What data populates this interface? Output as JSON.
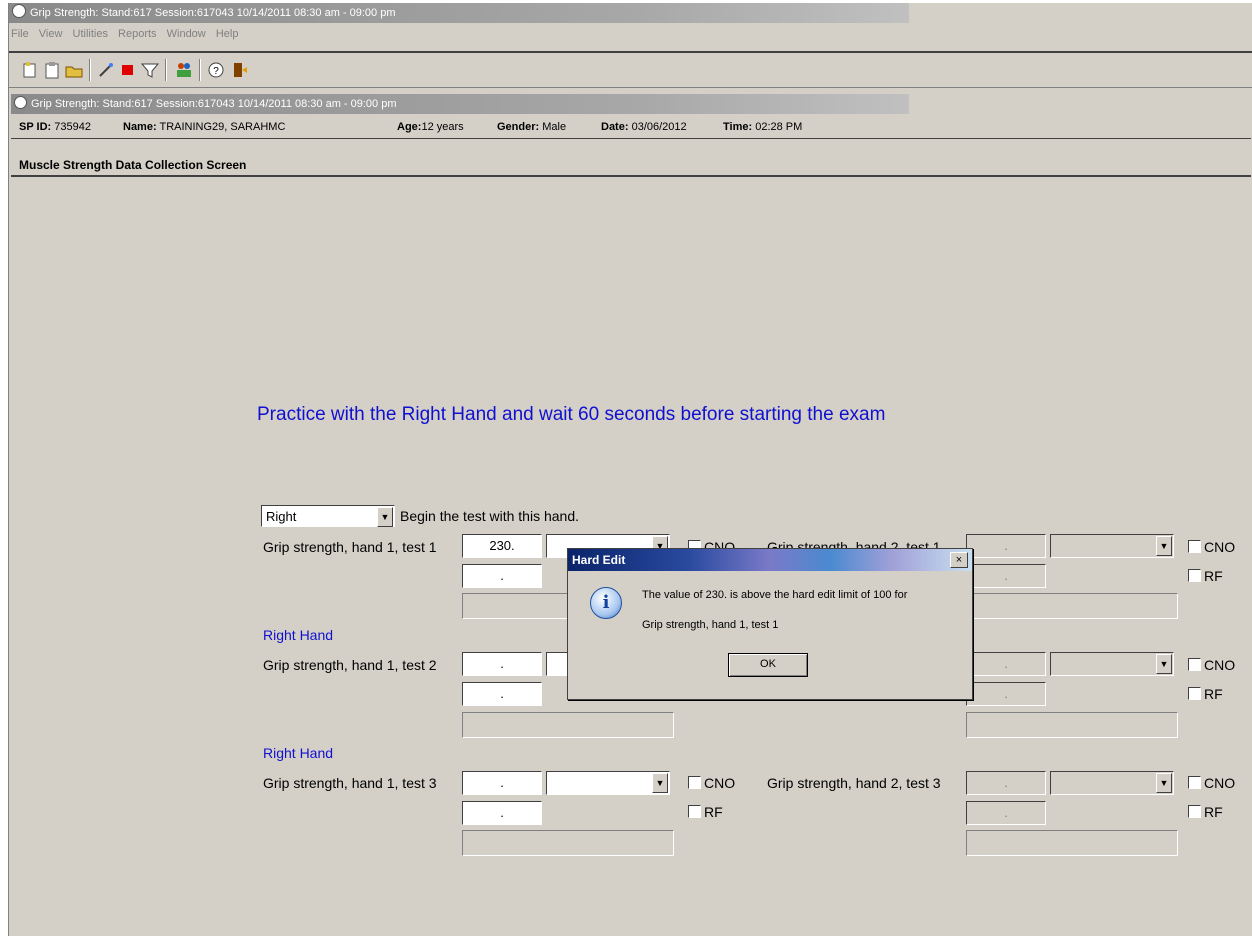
{
  "window": {
    "title": "Grip Strength: Stand:617 Session:617043 10/14/2011 08:30 am - 09:00 pm",
    "inner_title": "Grip Strength: Stand:617 Session:617043 10/14/2011 08:30 am - 09:00 pm"
  },
  "menu": {
    "file": "File",
    "view": "View",
    "utilities": "Utilities",
    "reports": "Reports",
    "window": "Window",
    "help": "Help"
  },
  "toolbar_icons": [
    "new-icon",
    "clipboard-icon",
    "open-folder-icon",
    "wand-icon",
    "stop-icon",
    "filter-icon",
    "people-icon",
    "help-icon",
    "exit-icon"
  ],
  "info": {
    "spid_label": "SP ID:",
    "spid": "735942",
    "name_label": "Name:",
    "name": "TRAINING29, SARAHMC",
    "age_label": "Age:",
    "age": "12 years",
    "gender_label": "Gender:",
    "gender": "Male",
    "date_label": "Date:",
    "date": "03/06/2012",
    "time_label": "Time:",
    "time": "02:28 PM"
  },
  "screen_title": "Muscle Strength Data Collection Screen",
  "instruction": "Practice with the Right Hand and wait 60 seconds before starting the exam",
  "hand_select": {
    "value": "Right",
    "label": "Begin the test with this hand."
  },
  "hand_label": "Right Hand",
  "tests": {
    "h1t1": {
      "label": "Grip strength, hand 1, test 1",
      "value": "230.",
      "sub": "."
    },
    "h1t2": {
      "label": "Grip strength, hand 1, test 2",
      "value": ".",
      "sub": "."
    },
    "h1t3": {
      "label": "Grip strength, hand 1, test 3",
      "value": ".",
      "sub": "."
    },
    "h2t1": {
      "label": "Grip strength, hand 2, test 1",
      "value": ".",
      "sub": "."
    },
    "h2t2": {
      "value": ".",
      "sub": "."
    },
    "h2t3": {
      "label": "Grip strength, hand 2, test 3",
      "value": ".",
      "sub": "."
    }
  },
  "checkbox": {
    "cno": "CNO",
    "rf": "RF"
  },
  "dialog": {
    "title": "Hard Edit",
    "close": "×",
    "icon": "info-icon",
    "message_line1": "The value of 230. is above the hard edit limit of 100 for",
    "message_line2": "Grip strength, hand 1, test 1",
    "ok": "OK"
  },
  "colors": {
    "instruction": "#1010d0",
    "dialog_title": "#0a246a",
    "background": "#d4d0c8"
  }
}
